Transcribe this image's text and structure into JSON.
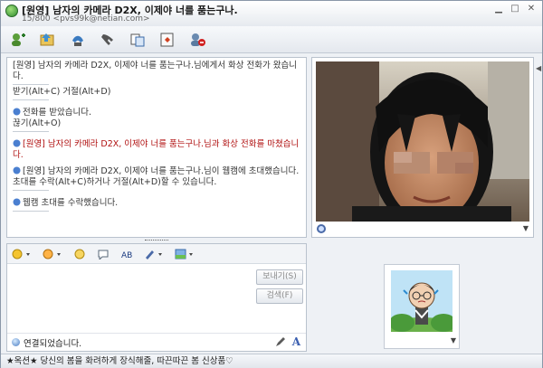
{
  "window": {
    "title": "[원영] 남자의 카메라 D2X, 이제야 너를 품는구나.",
    "subtitle": "15/800 <pvs99k@netian.com>"
  },
  "toolbar": {
    "buttons": [
      "add-friend-icon",
      "send-file-icon",
      "call-icon",
      "hangup-icon",
      "share-icon",
      "remote-icon",
      "block-icon"
    ]
  },
  "chat": {
    "messages": [
      {
        "text": "[원영] 남자의 카메라 D2X, 이제야 너를 품는구나.님에게서 화상 전화가 왔습니다.",
        "style": "normal",
        "icon": false
      },
      {
        "text": "받기(Alt+C)          거절(Alt+D)",
        "style": "normal",
        "icon": false
      },
      {
        "text": "전화를 받았습니다.",
        "style": "normal",
        "icon": true
      },
      {
        "text": "끊기(Alt+O)",
        "style": "normal",
        "icon": false
      },
      {
        "text": "[원영] 남자의 카메라 D2X, 이제야 너를 품는구나.님과 화상 전화를 마쳤습니다.",
        "style": "red",
        "icon": true
      },
      {
        "text": "[원영] 남자의 카메라 D2X, 이제야 너를 품는구나.님이 웹캠에 초대했습니다. 초대를 수락(Alt+C)하거나 거절(Alt+D)할 수 있습니다.",
        "style": "normal",
        "icon": true
      },
      {
        "text": "웹캠 초대를 수락했습니다.",
        "style": "normal",
        "icon": true
      }
    ]
  },
  "input": {
    "send_label": "보내기(S)",
    "find_label": "검색(F)",
    "status_text": "연결되었습니다."
  },
  "footer": {
    "text": "★옥션★ 당신의 봄을 화려하게 장식해줄, 따끈따끈 봄 신상품♡"
  },
  "colors": {
    "accent": "#4a6aa8",
    "alert_red": "#b01010"
  }
}
